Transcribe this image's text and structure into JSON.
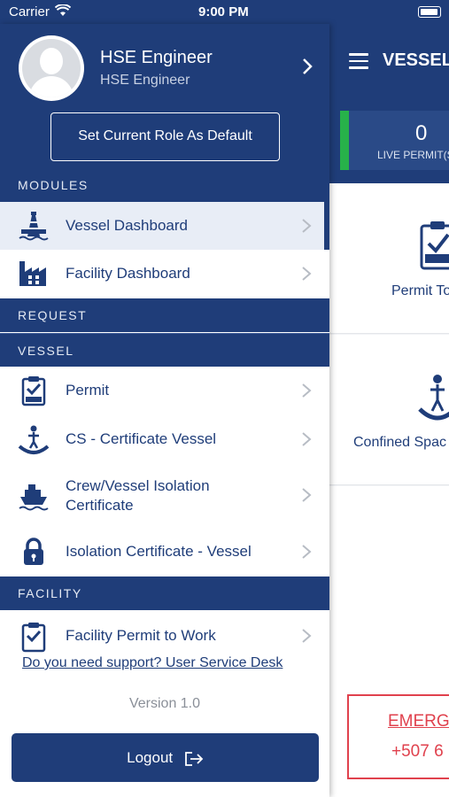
{
  "status_bar": {
    "carrier": "Carrier",
    "time": "9:00 PM"
  },
  "background_app": {
    "title": "VESSEL",
    "stat": {
      "value": "0",
      "label": "LIVE PERMIT(S"
    },
    "tiles": [
      {
        "label": "Permit To",
        "icon": "permit-clipboard-icon"
      },
      {
        "label": "Confined Spac",
        "icon": "confined-space-icon"
      }
    ],
    "emergency": {
      "title": "EMERG",
      "phone": "+507 6"
    }
  },
  "drawer": {
    "profile": {
      "name": "HSE Engineer",
      "role": "HSE Engineer",
      "set_role_button": "Set Current Role As Default"
    },
    "sections": {
      "modules": "MODULES",
      "request": "REQUEST",
      "vessel": "VESSEL",
      "facility": "FACILITY"
    },
    "modules": [
      {
        "label": "Vessel Dashboard",
        "icon": "oil-rig-icon",
        "active": true
      },
      {
        "label": "Facility Dashboard",
        "icon": "factory-icon",
        "active": false
      }
    ],
    "vessel_items": [
      {
        "label": "Permit",
        "icon": "permit-clipboard-icon"
      },
      {
        "label": "CS - Certificate Vessel",
        "icon": "confined-space-icon"
      },
      {
        "label": "Crew/Vessel Isolation Certificate",
        "line1": "Crew/Vessel Isolation",
        "line2": "Certificate",
        "icon": "ship-icon"
      },
      {
        "label": "Isolation Certificate - Vessel",
        "icon": "lock-icon"
      }
    ],
    "facility_items": [
      {
        "label": "Facility Permit to Work",
        "icon": "permit-check-icon"
      }
    ],
    "support_link": "Do you need support? User Service Desk",
    "version": "Version 1.0",
    "logout": "Logout"
  },
  "colors": {
    "primary": "#1f3d79",
    "accent_green": "#27b24a",
    "emergency_red": "#e0414d"
  }
}
